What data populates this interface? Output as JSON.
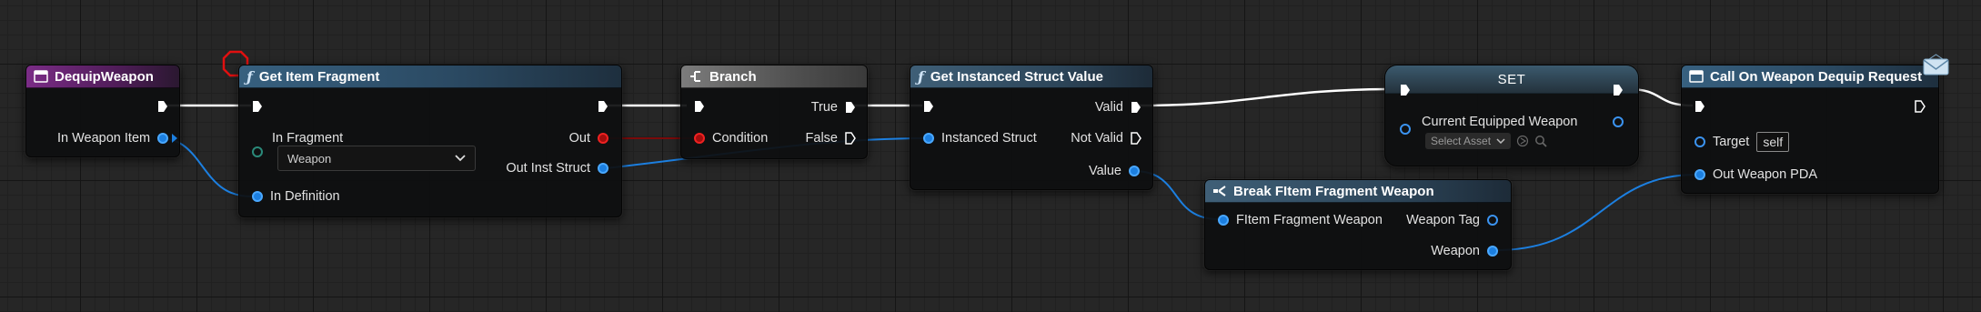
{
  "nodes": {
    "dequip": {
      "title": "DequipWeapon",
      "pin_in_weapon_item": "In Weapon Item"
    },
    "get_fragment": {
      "title": "Get Item Fragment",
      "pin_in_fragment": "In Fragment",
      "fragment_value": "Weapon",
      "pin_in_definition": "In Definition",
      "pin_out": "Out",
      "pin_out_inst_struct": "Out Inst Struct"
    },
    "branch": {
      "title": "Branch",
      "pin_condition": "Condition",
      "pin_true": "True",
      "pin_false": "False"
    },
    "get_instanced": {
      "title": "Get Instanced Struct Value",
      "pin_instanced_struct": "Instanced Struct",
      "pin_valid": "Valid",
      "pin_not_valid": "Not Valid",
      "pin_value": "Value"
    },
    "break_fragment": {
      "title": "Break FItem Fragment Weapon",
      "pin_in": "FItem Fragment Weapon",
      "pin_weapon_tag": "Weapon Tag",
      "pin_weapon": "Weapon"
    },
    "set": {
      "title": "SET",
      "pin_current_weapon": "Current Equipped Weapon",
      "select_placeholder": "Select Asset"
    },
    "call_dequip": {
      "title": "Call On Weapon Dequip Request",
      "pin_target": "Target",
      "target_value": "self",
      "pin_out_weapon_pda": "Out Weapon PDA"
    }
  },
  "colors": {
    "exec_wire": "#ffffff",
    "object_wire": "#1c7fe0",
    "bool_wire": "#8b0000",
    "event_header": "#7a2c86",
    "function_header": "#37607f"
  }
}
